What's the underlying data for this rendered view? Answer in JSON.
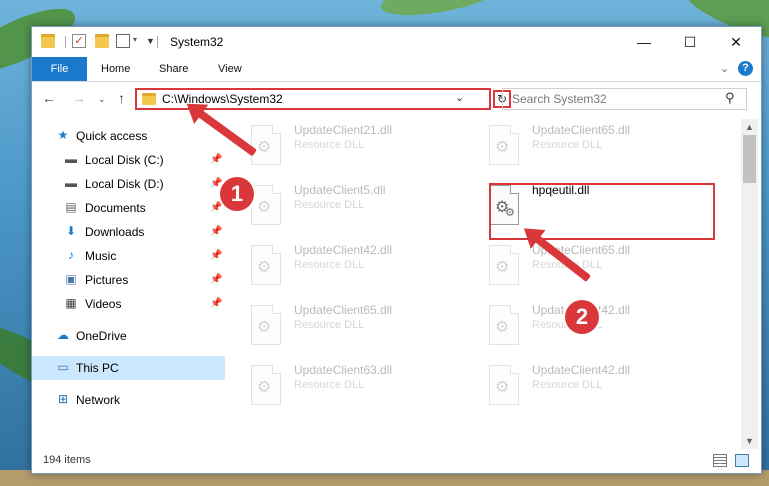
{
  "window": {
    "title": "System32"
  },
  "titlebar": {
    "minimize": "—",
    "maximize": "☐",
    "close": "✕"
  },
  "ribbon": {
    "tabs": [
      {
        "label": "File"
      },
      {
        "label": "Home"
      },
      {
        "label": "Share"
      },
      {
        "label": "View"
      }
    ]
  },
  "nav": {
    "address": "C:\\Windows\\System32",
    "search_placeholder": "Search System32"
  },
  "sidebar": {
    "items": [
      {
        "label": "Quick access"
      },
      {
        "label": "Local Disk (C:)"
      },
      {
        "label": "Local Disk (D:)"
      },
      {
        "label": "Documents"
      },
      {
        "label": "Downloads"
      },
      {
        "label": "Music"
      },
      {
        "label": "Pictures"
      },
      {
        "label": "Videos"
      },
      {
        "label": "OneDrive"
      },
      {
        "label": "This PC"
      },
      {
        "label": "Network"
      }
    ]
  },
  "files": [
    {
      "name": "UpdateClient21.dll",
      "type": "Resource DLL"
    },
    {
      "name": "UpdateClient65.dll",
      "type": "Resource DLL"
    },
    {
      "name": "UpdateClient5.dll",
      "type": "Resource DLL"
    },
    {
      "name": "hpqeutil.dll",
      "type": ""
    },
    {
      "name": "UpdateClient42.dll",
      "type": "Resource DLL"
    },
    {
      "name": "UpdateClient65.dll",
      "type": "Resource DLL"
    },
    {
      "name": "UpdateClient65.dll",
      "type": "Resource DLL"
    },
    {
      "name": "UpdateClient42.dll",
      "type": "Resource DLL"
    },
    {
      "name": "UpdateClient63.dll",
      "type": "Resource DLL"
    },
    {
      "name": "UpdateClient42.dll",
      "type": "Resource DLL"
    }
  ],
  "status": {
    "item_count": "194 items"
  },
  "annotations": {
    "step1": "1",
    "step2": "2",
    "color": "#d9373a"
  }
}
